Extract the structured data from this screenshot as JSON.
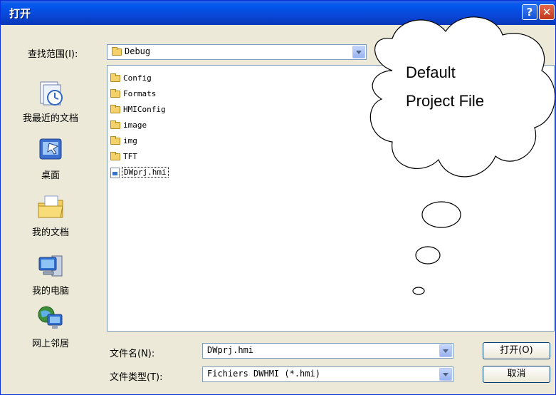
{
  "window": {
    "title": "打开",
    "help_button": "?",
    "close_button": "✕"
  },
  "lookin": {
    "label": "查找范围(I):",
    "value": "Debug"
  },
  "places": [
    {
      "label": "我最近的文档",
      "icon": "recent-documents-icon"
    },
    {
      "label": "桌面",
      "icon": "desktop-icon"
    },
    {
      "label": "我的文档",
      "icon": "my-documents-icon"
    },
    {
      "label": "我的电脑",
      "icon": "my-computer-icon"
    },
    {
      "label": "网上邻居",
      "icon": "network-places-icon"
    }
  ],
  "files": [
    {
      "name": "Config",
      "type": "folder"
    },
    {
      "name": "Formats",
      "type": "folder"
    },
    {
      "name": "HMIConfig",
      "type": "folder"
    },
    {
      "name": "image",
      "type": "folder"
    },
    {
      "name": "img",
      "type": "folder"
    },
    {
      "name": "TFT",
      "type": "folder"
    },
    {
      "name": "DWprj.hmi",
      "type": "file",
      "selected": true
    }
  ],
  "filename": {
    "label": "文件名(N):",
    "value": "DWprj.hmi"
  },
  "filetype": {
    "label": "文件类型(T):",
    "value": "Fichiers DWHMI (*.hmi)"
  },
  "buttons": {
    "open": "打开(O)",
    "cancel": "取消"
  },
  "callout": {
    "line1": "Default",
    "line2": "Project File"
  }
}
